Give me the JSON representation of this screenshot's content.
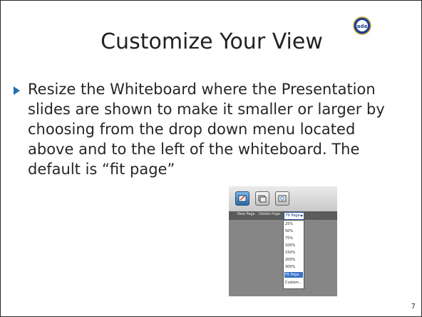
{
  "slide": {
    "title": "Customize Your View",
    "bullet_lines": [
      "Resize the Whiteboard where the Presentation",
      "slides are shown to make it smaller or larger by",
      "choosing from the drop down menu located",
      "above and to the left of the whiteboard.   The",
      "default is “fit page”"
    ],
    "page_number": "7",
    "logo_icon": "ada-seal-icon",
    "bullet_color": "#1f6fb3"
  },
  "screenshot": {
    "toolbar_icons": [
      "whiteboard-icon",
      "window-icon",
      "share-icon"
    ],
    "subbar": {
      "new_page": "New Page",
      "delete_page": "Delete Page",
      "selected_zoom": "Fit Page"
    },
    "zoom_options": [
      "25%",
      "50%",
      "75%",
      "100%",
      "150%",
      "200%",
      "300%",
      "Fit Page",
      "Custom..."
    ],
    "selected_option": "Fit Page"
  }
}
